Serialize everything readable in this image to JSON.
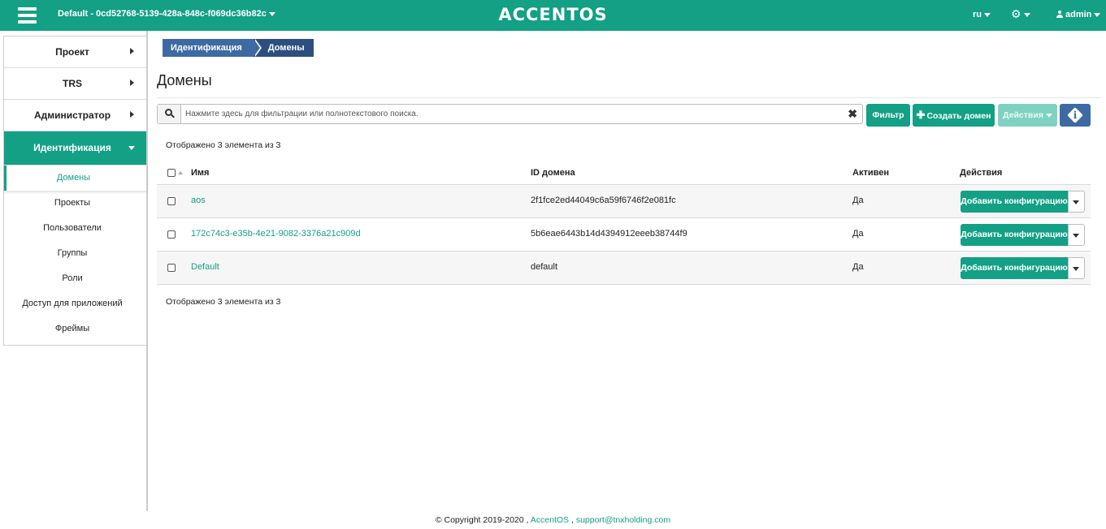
{
  "topbar": {
    "project": "Default - 0cd52768-5139-428a-848c-f069dc36b82c",
    "logo": "ACCENTOS",
    "lang": "ru",
    "user": "admin",
    "gear_icon": "gear-icon",
    "menu_icon": "hamburger-icon"
  },
  "sidebar": {
    "sections": [
      {
        "label": "Проект"
      },
      {
        "label": "TRS"
      },
      {
        "label": "Администратор"
      },
      {
        "label": "Идентификация"
      }
    ],
    "items": [
      {
        "label": "Домены"
      },
      {
        "label": "Проекты"
      },
      {
        "label": "Пользователи"
      },
      {
        "label": "Группы"
      },
      {
        "label": "Роли"
      },
      {
        "label": "Доступ для приложений"
      },
      {
        "label": "Фреймы"
      }
    ]
  },
  "breadcrumb": {
    "items": [
      {
        "label": "Идентификация"
      },
      {
        "label": "Домены"
      }
    ]
  },
  "page": {
    "title": "Домены",
    "search_placeholder": "Нажмите здесь для фильтрации или полнотекстового поиска.",
    "search_clear": "✖",
    "buttons": {
      "filter": "Фильтр",
      "create": "Создать домен",
      "actions": "Действия"
    },
    "count_text": "Отображено 3 элемента из 3"
  },
  "table": {
    "headers": {
      "name": "Имя",
      "id": "ID домена",
      "active": "Активен",
      "actions": "Действия"
    },
    "rows": [
      {
        "name": "aos",
        "id": "2f1fce2ed44049c6a59f6746f2e081fc",
        "active": "Да",
        "action": "Добавить конфигурацию"
      },
      {
        "name": "172c74c3-e35b-4e21-9082-3376a21c909d",
        "id": "5b6eae6443b14d4394912eeeb38744f9",
        "active": "Да",
        "action": "Добавить конфигурацию"
      },
      {
        "name": "Default",
        "id": "default",
        "active": "Да",
        "action": "Добавить конфигурацию"
      }
    ]
  },
  "footer": {
    "copyright": "© Copyright 2019-2020 ,",
    "brand": "AccentOS",
    "sep": ",",
    "email": "support@tnxholding.com"
  },
  "colors": {
    "accent": "#13a085",
    "breadcrumb": "#3d6aa3",
    "info": "#3d6aa3"
  }
}
